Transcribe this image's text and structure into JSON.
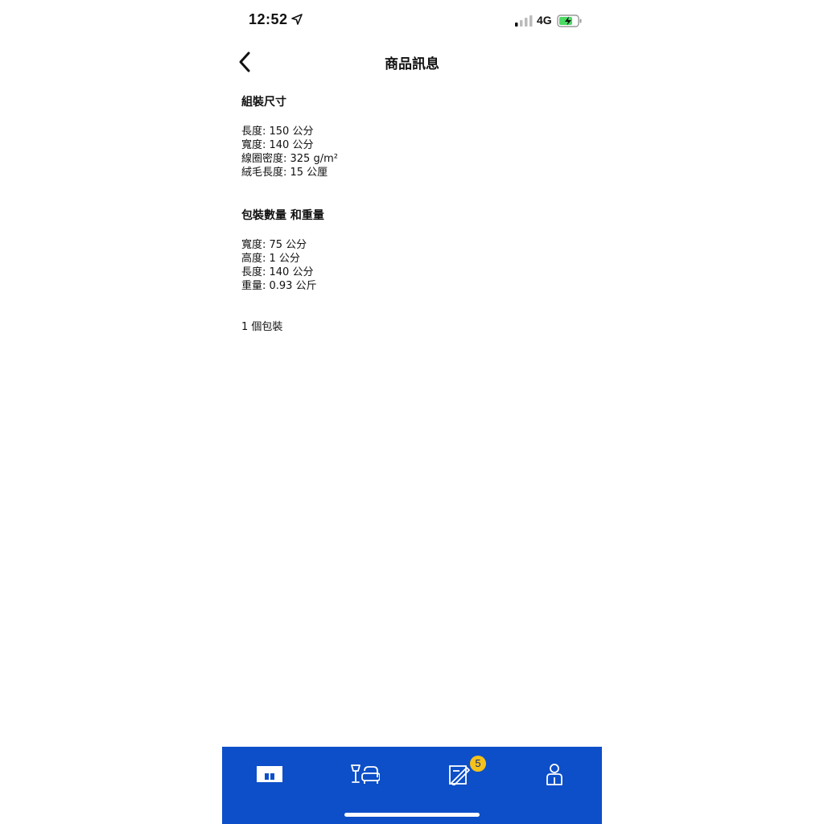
{
  "status_bar": {
    "time": "12:52",
    "network": "4G",
    "icons": [
      "location-arrow-icon",
      "signal-icon",
      "battery-charging-icon"
    ]
  },
  "nav": {
    "title": "商品訊息",
    "back_icon": "chevron-left-icon"
  },
  "sections": [
    {
      "title": "組裝尺寸",
      "lines": [
        "長度: 150 公分",
        "寬度: 140 公分",
        "線圈密度: 325 g/m²",
        "絨毛長度: 15 公厘"
      ]
    },
    {
      "title": "包裝數量 和重量",
      "lines": [
        "寬度: 75 公分",
        "高度: 1 公分",
        "長度: 140 公分",
        "重量: 0.93 公斤"
      ]
    }
  ],
  "package_count": "1 個包裝",
  "tab_bar": {
    "background": "#0d4fc8",
    "tabs": [
      {
        "icon": "home-icon",
        "selected": true
      },
      {
        "icon": "rooms-icon",
        "selected": false
      },
      {
        "icon": "shopping-list-icon",
        "selected": false,
        "badge": "5"
      },
      {
        "icon": "profile-icon",
        "selected": false
      }
    ]
  }
}
